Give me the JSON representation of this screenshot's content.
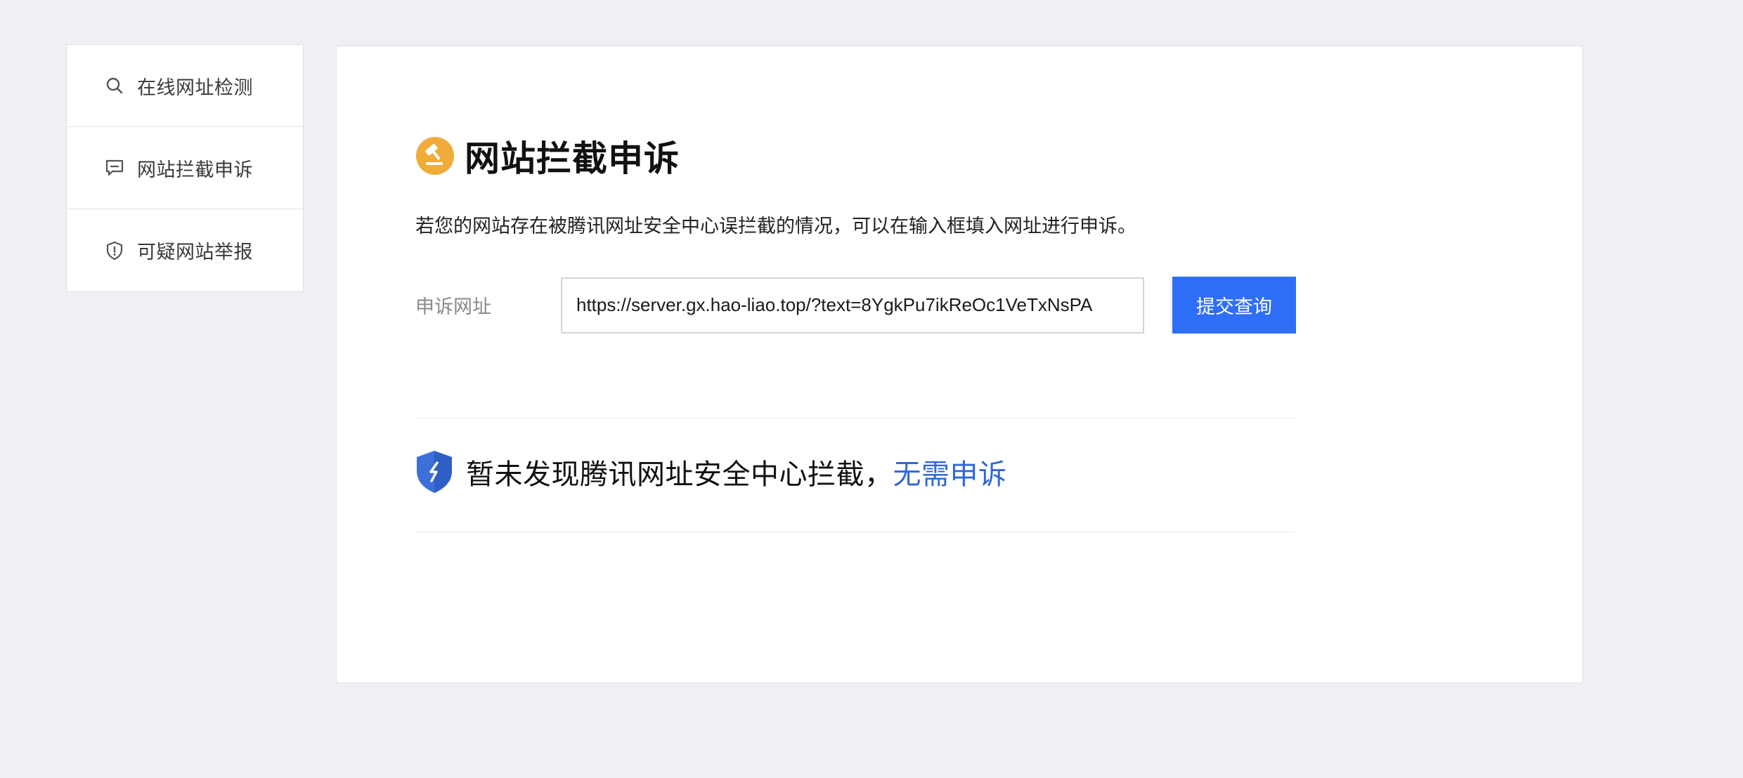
{
  "sidebar": {
    "items": [
      {
        "label": "在线网址检测",
        "icon": "search-icon"
      },
      {
        "label": "网站拦截申诉",
        "icon": "comment-icon"
      },
      {
        "label": "可疑网站举报",
        "icon": "shield-alert-icon"
      }
    ]
  },
  "main": {
    "title": "网站拦截申诉",
    "title_icon": "gavel-icon",
    "description": "若您的网站存在被腾讯网址安全中心误拦截的情况，可以在输入框填入网址进行申诉。",
    "form": {
      "label": "申诉网址",
      "url_value": "https://server.gx.hao-liao.top/?text=8YgkPu7ikReOc1VeTxNsPA",
      "submit_label": "提交查询"
    },
    "result": {
      "icon": "shield-check-icon",
      "text": "暂未发现腾讯网址安全中心拦截，",
      "link_text": "无需申诉"
    }
  },
  "colors": {
    "page_background": "#efeff4",
    "accent_blue": "#2f6ef6",
    "link_blue": "#2f67d6",
    "title_icon_orange": "#f0ac3a",
    "shield_blue": "#3d6fd8"
  }
}
